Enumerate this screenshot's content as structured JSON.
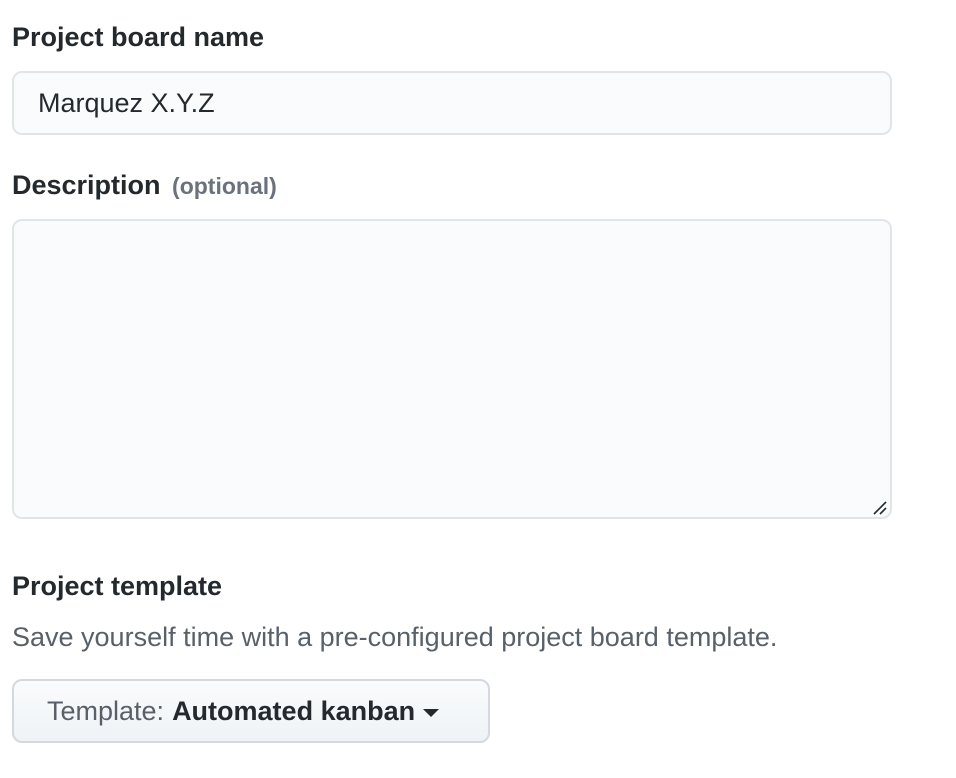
{
  "form": {
    "name_label": "Project board name",
    "name_value": "Marquez X.Y.Z",
    "description_label": "Description",
    "description_optional": "(optional)",
    "description_value": "",
    "template_heading": "Project template",
    "template_note": "Save yourself time with a pre-configured project board template.",
    "template_prefix": "Template:",
    "template_selected": "Automated kanban"
  },
  "icons": {
    "dropdown": "caret-down-icon",
    "resize": "resize-handle-icon"
  }
}
